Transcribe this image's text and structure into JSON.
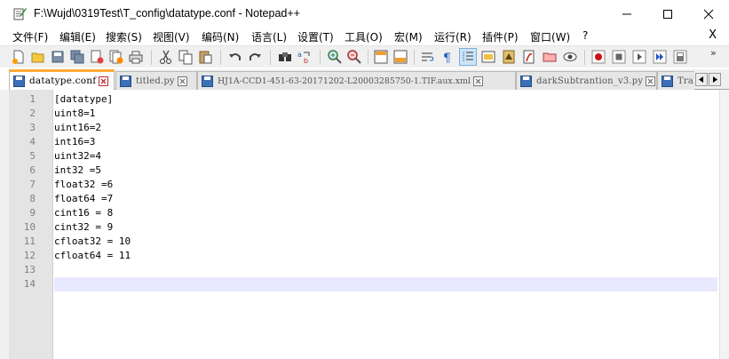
{
  "window": {
    "title": "F:\\Wujd\\0319Test\\T_config\\datatype.conf - Notepad++"
  },
  "menu": {
    "items": [
      "文件(F)",
      "编辑(E)",
      "搜索(S)",
      "视图(V)",
      "编码(N)",
      "语言(L)",
      "设置(T)",
      "工具(O)",
      "宏(M)",
      "运行(R)",
      "插件(P)",
      "窗口(W)",
      "?"
    ],
    "close_label": "X"
  },
  "toolbar": {
    "more_label": "»"
  },
  "tabs": [
    {
      "label": "datatype.conf",
      "active": true
    },
    {
      "label": "titled.py",
      "active": false
    },
    {
      "label": "HJ1A-CCD1-451-63-20171202-L20003285750-1.TIF.aux.xml",
      "active": false
    },
    {
      "label": "darkSubtrantion_v3.py",
      "active": false
    },
    {
      "label": "Tra",
      "active": false
    }
  ],
  "editor": {
    "lines": [
      {
        "n": "1",
        "text": "[datatype]"
      },
      {
        "n": "2",
        "text": "uint8=1"
      },
      {
        "n": "3",
        "text": "uint16=2"
      },
      {
        "n": "4",
        "text": "int16=3"
      },
      {
        "n": "5",
        "text": "uint32=4"
      },
      {
        "n": "6",
        "text": "int32 =5"
      },
      {
        "n": "7",
        "text": "float32 =6"
      },
      {
        "n": "8",
        "text": "float64 =7"
      },
      {
        "n": "9",
        "text": "cint16 = 8"
      },
      {
        "n": "10",
        "text": "cint32 = 9"
      },
      {
        "n": "11",
        "text": "cfloat32 = 10"
      },
      {
        "n": "12",
        "text": "cfloat64 = 11"
      },
      {
        "n": "13",
        "text": ""
      },
      {
        "n": "14",
        "text": ""
      }
    ]
  },
  "colors": {
    "active_tab_accent": "#ffaa33",
    "current_line": "#e8e8ff",
    "gutter": "#e4e4e4",
    "line_number": "#808080"
  }
}
